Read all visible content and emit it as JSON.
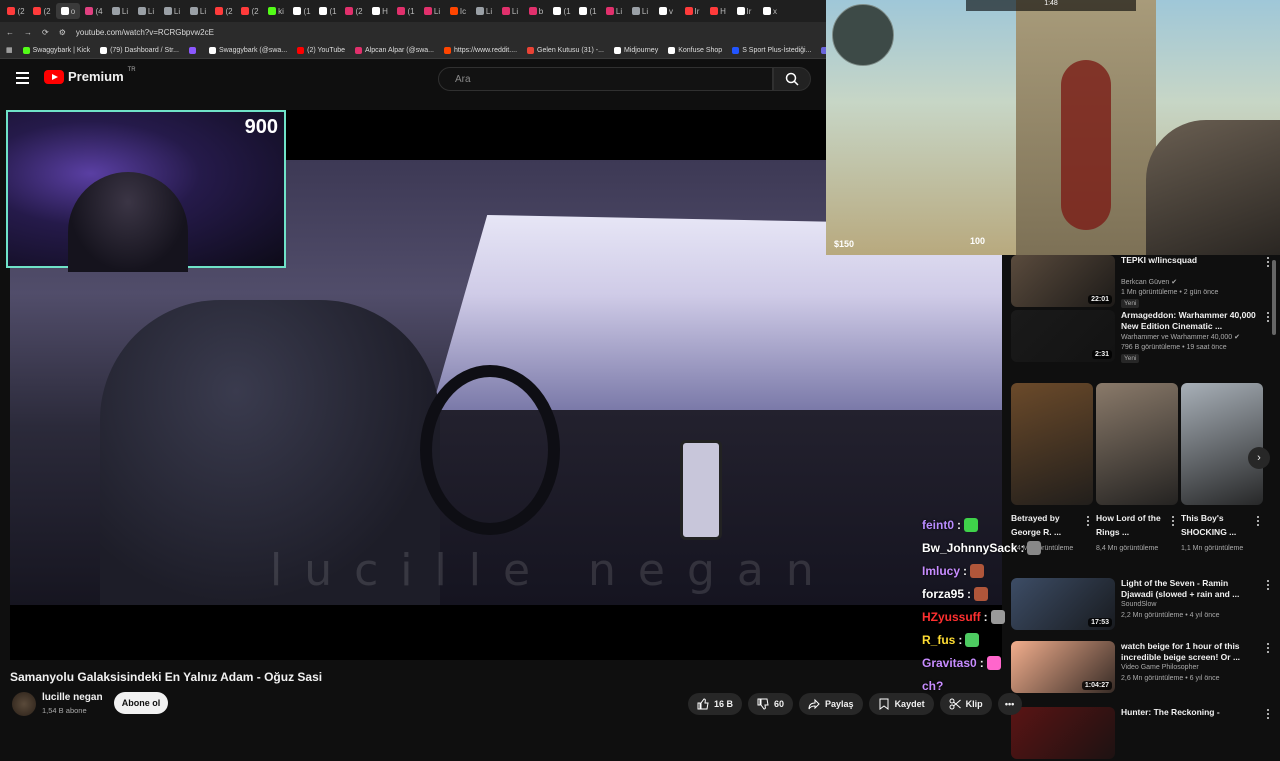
{
  "browser": {
    "url": "youtube.com/watch?v=RCRGbpvw2cE",
    "tabs": [
      {
        "label": "(2",
        "color": "#ff3b3b"
      },
      {
        "label": "(2",
        "color": "#ff3b3b"
      },
      {
        "label": "o",
        "color": "#ffffff"
      },
      {
        "label": "(4",
        "color": "#e04080"
      },
      {
        "label": "Li",
        "color": "#9aa0a6"
      },
      {
        "label": "Li",
        "color": "#9aa0a6"
      },
      {
        "label": "Li",
        "color": "#9aa0a6"
      },
      {
        "label": "Li",
        "color": "#9aa0a6"
      },
      {
        "label": "(2",
        "color": "#ff3b3b"
      },
      {
        "label": "(2",
        "color": "#ff3b3b"
      },
      {
        "label": "ki",
        "color": "#53fc18"
      },
      {
        "label": "(1",
        "color": "#ffffff"
      },
      {
        "label": "(1",
        "color": "#ffffff"
      },
      {
        "label": "(2",
        "color": "#e1306c"
      },
      {
        "label": "H",
        "color": "#ffffff"
      },
      {
        "label": "(1",
        "color": "#e1306c"
      },
      {
        "label": "Li",
        "color": "#e1306c"
      },
      {
        "label": "Ic",
        "color": "#ff4500"
      },
      {
        "label": "Li",
        "color": "#9aa0a6"
      },
      {
        "label": "Li",
        "color": "#e1306c"
      },
      {
        "label": "b",
        "color": "#e1306c"
      },
      {
        "label": "(1",
        "color": "#ffffff"
      },
      {
        "label": "(1",
        "color": "#ffffff"
      },
      {
        "label": "Li",
        "color": "#e1306c"
      },
      {
        "label": "Li",
        "color": "#9aa0a6"
      },
      {
        "label": "v",
        "color": "#ffffff"
      },
      {
        "label": "Ir",
        "color": "#ff3b3b"
      },
      {
        "label": "H",
        "color": "#ff3b3b"
      },
      {
        "label": "Ir",
        "color": "#ffffff"
      },
      {
        "label": "x",
        "color": "#ffffff"
      }
    ],
    "bookmarks": [
      {
        "label": "Swaggybark | Kick",
        "color": "#53fc18"
      },
      {
        "label": "(79) Dashboard / Str...",
        "color": "#ffffff"
      },
      {
        "label": "",
        "color": "#8c58ff"
      },
      {
        "label": "Swaggybark (@swa...",
        "color": "#ffffff"
      },
      {
        "label": "(2) YouTube",
        "color": "#ff0000"
      },
      {
        "label": "Alpcan Alpar (@swa...",
        "color": "#e1306c"
      },
      {
        "label": "https://www.reddit....",
        "color": "#ff4500"
      },
      {
        "label": "Gelen Kutusu (31) -...",
        "color": "#ea4335"
      },
      {
        "label": "Midjourney",
        "color": "#ffffff"
      },
      {
        "label": "Konfuse Shop",
        "color": "#ffffff"
      },
      {
        "label": "S Sport Plus-İstediği...",
        "color": "#2255ff"
      },
      {
        "label": "Excalidraw | Hand-d...",
        "color": "#6965db"
      },
      {
        "label": "htt",
        "color": "#ff4500"
      }
    ]
  },
  "header": {
    "brand": "Premium",
    "region": "TR",
    "search_placeholder": "Ara"
  },
  "webcam": {
    "counter": "900"
  },
  "video": {
    "watermark": "lucille negan",
    "title": "Samanyolu Galaksisindeki En Yalnız Adam - Oğuz Sasi",
    "channel": "lucille negan",
    "subscribers": "1,54 B abone",
    "subscribe_label": "Abone ol",
    "likes": "16 B",
    "dislikes": "60",
    "share_label": "Paylaş",
    "save_label": "Kaydet",
    "clip_label": "Klip"
  },
  "game": {
    "money": "$150",
    "ammo": "100",
    "topbar": "1:48"
  },
  "recommendations": [
    {
      "title": "TEPKI w/lincsquad",
      "channel": "Berkcan Güven",
      "verified": true,
      "views": "1 Mn görüntüleme",
      "age": "2 gün önce",
      "badge": "Yeni",
      "duration": "22:01",
      "thumb_color": "#5a4b3d"
    },
    {
      "title": "Armageddon: Warhammer 40,000 New Edition Cinematic ...",
      "channel": "Warhammer ve Warhammer 40,000",
      "verified": true,
      "views": "796 B görüntüleme",
      "age": "19 saat önce",
      "badge": "Yeni",
      "duration": "2:31",
      "thumb_color": "#1a1a1a"
    },
    {
      "title": "Light of the Seven - Ramin Djawadi (slowed + rain and ...",
      "channel": "SoundSlow",
      "verified": false,
      "views": "2,2 Mn görüntüleme",
      "age": "4 yıl önce",
      "badge": "",
      "duration": "17:53",
      "thumb_color": "#3d4d66"
    },
    {
      "title": "watch beige for 1 hour of this incredible beige screen! Or ...",
      "channel": "Video Game Philosopher",
      "verified": false,
      "views": "2,6 Mn görüntüleme",
      "age": "6 yıl önce",
      "badge": "",
      "duration": "1:04:27",
      "thumb_color": "#f2ae8d"
    },
    {
      "title": "Hunter: The Reckoning -",
      "channel": "",
      "verified": false,
      "views": "",
      "age": "",
      "badge": "",
      "duration": "",
      "thumb_color": "#5a1414"
    }
  ],
  "shorts": [
    {
      "title": "Betrayed by George R. ...",
      "views": "8,4 Mn görüntüleme",
      "thumb_color": "#6b4a2a"
    },
    {
      "title": "How Lord of the Rings ...",
      "views": "8,4 Mn görüntüleme",
      "thumb_color": "#8a7a6a"
    },
    {
      "title": "This Boy's SHOCKING ...",
      "views": "1,1 Mn görüntüleme",
      "thumb_color": "#a8b0b8"
    }
  ],
  "chat": [
    {
      "user": "feint0",
      "color": "#b98cff",
      "text": ":",
      "emote": "#3fd24a"
    },
    {
      "user": "Bw_JohnnySack",
      "color": "#ffffff",
      "text": ":",
      "emote": "#888888"
    },
    {
      "user": "Imlucy",
      "color": "#c78cff",
      "text": ":",
      "emote": "#b0563a"
    },
    {
      "user": "forza95",
      "color": "#ffffff",
      "text": ":",
      "emote": "#b0563a"
    },
    {
      "user": "HZyussuff",
      "color": "#ff3030",
      "text": ":",
      "emote": "#999999"
    },
    {
      "user": "R_fus",
      "color": "#ffdd33",
      "text": ":",
      "emote": "#4ecb62"
    },
    {
      "user": "Gravitas0",
      "color": "#c78cff",
      "text": ":",
      "emote": "#ff66cc"
    },
    {
      "user": "ch?",
      "color": "#c78cff",
      "text": "",
      "emote": ""
    }
  ]
}
